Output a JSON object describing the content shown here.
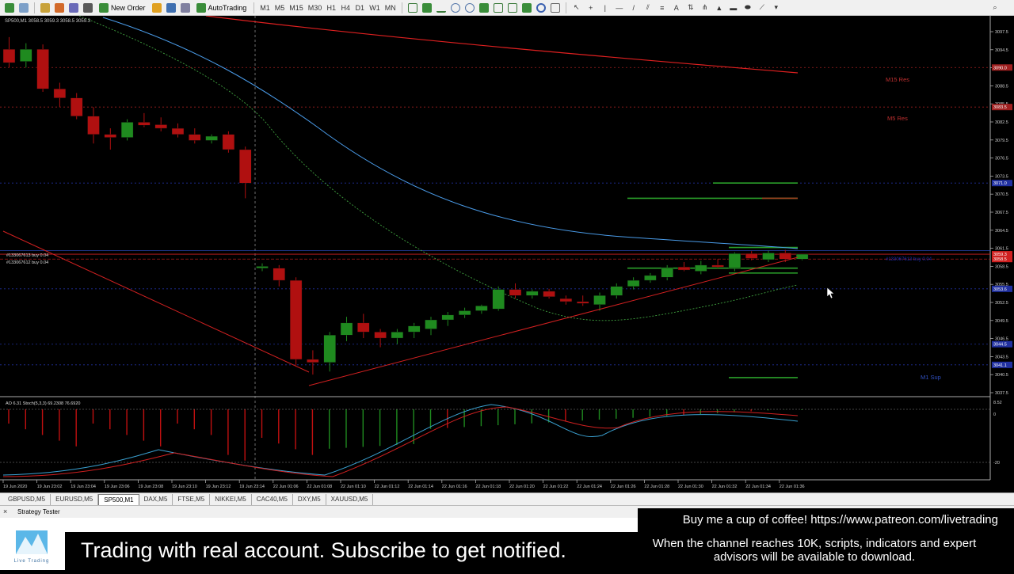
{
  "toolbar": {
    "new_order": "New Order",
    "auto_trading": "AutoTrading",
    "timeframes": [
      "M1",
      "M5",
      "M15",
      "M30",
      "H1",
      "H4",
      "D1",
      "W1",
      "MN"
    ]
  },
  "chart": {
    "symbol_info": "SP500,M1  3058.5 3059.3 3058.5 3059.3",
    "order_labels": [
      "#133067613 buy 0.04",
      "#133067612 buy 0.04"
    ],
    "level_labels": {
      "m15": "M15 Res",
      "m5": "M5 Res",
      "m1": "M1 Sup"
    },
    "right_order_label": "#133067613 buy 0.04",
    "price_axis": [
      "3097.5",
      "3094.5",
      "3091.5",
      "3088.5",
      "3085.5",
      "3082.5",
      "3079.5",
      "3076.5",
      "3073.5",
      "3070.5",
      "3067.5",
      "3064.5",
      "3061.5",
      "3058.5",
      "3055.5",
      "3052.5",
      "3049.5",
      "3046.5",
      "3043.5",
      "3040.5",
      "3037.5"
    ],
    "price_tags": [
      "3090.0",
      "3083.5",
      "3071.0",
      "3059.3",
      "3058.5",
      "3053.6",
      "3044.5",
      "3041.1"
    ],
    "indicator_label": "AO 6.31  Stoch(5,3,3) 69.2308 76.6920",
    "indicator_axis": [
      "8.52",
      "0",
      "-20"
    ],
    "time_axis": [
      "19 Jun 2020",
      "19 Jun 23:02",
      "19 Jun 23:04",
      "19 Jun 23:06",
      "19 Jun 23:08",
      "19 Jun 23:10",
      "19 Jun 23:12",
      "19 Jun 23:14",
      "22 Jun 01:06",
      "22 Jun 01:08",
      "22 Jun 01:10",
      "22 Jun 01:12",
      "22 Jun 01:14",
      "22 Jun 01:16",
      "22 Jun 01:18",
      "22 Jun 01:20",
      "22 Jun 01:22",
      "22 Jun 01:24",
      "22 Jun 01:26",
      "22 Jun 01:28",
      "22 Jun 01:30",
      "22 Jun 01:32",
      "22 Jun 01:34",
      "22 Jun 01:36"
    ],
    "candles": [
      {
        "o": 3093.0,
        "h": 3095.0,
        "l": 3090.0,
        "c": 3090.8
      },
      {
        "o": 3091.0,
        "h": 3094.0,
        "l": 3090.0,
        "c": 3093.0
      },
      {
        "o": 3093.0,
        "h": 3093.8,
        "l": 3086.0,
        "c": 3086.5
      },
      {
        "o": 3086.5,
        "h": 3087.5,
        "l": 3083.5,
        "c": 3085.0
      },
      {
        "o": 3085.0,
        "h": 3085.8,
        "l": 3081.5,
        "c": 3082.0
      },
      {
        "o": 3082.0,
        "h": 3083.5,
        "l": 3077.5,
        "c": 3079.0
      },
      {
        "o": 3079.0,
        "h": 3080.0,
        "l": 3076.5,
        "c": 3078.5
      },
      {
        "o": 3078.5,
        "h": 3081.5,
        "l": 3078.0,
        "c": 3081.0
      },
      {
        "o": 3081.0,
        "h": 3082.5,
        "l": 3080.2,
        "c": 3080.5
      },
      {
        "o": 3080.6,
        "h": 3081.8,
        "l": 3079.5,
        "c": 3080.0
      },
      {
        "o": 3080.0,
        "h": 3080.8,
        "l": 3078.5,
        "c": 3079.0
      },
      {
        "o": 3079.0,
        "h": 3080.0,
        "l": 3077.5,
        "c": 3078.0
      },
      {
        "o": 3078.0,
        "h": 3079.0,
        "l": 3077.5,
        "c": 3078.7
      },
      {
        "o": 3079.0,
        "h": 3079.5,
        "l": 3076.0,
        "c": 3076.5
      },
      {
        "o": 3076.5,
        "h": 3077.0,
        "l": 3068.5,
        "c": 3071.0
      },
      {
        "o": 3057.0,
        "h": 3057.8,
        "l": 3056.5,
        "c": 3057.3
      },
      {
        "o": 3057.0,
        "h": 3057.5,
        "l": 3054.0,
        "c": 3055.0
      },
      {
        "o": 3055.0,
        "h": 3055.5,
        "l": 3041.0,
        "c": 3042.0
      },
      {
        "o": 3042.0,
        "h": 3043.5,
        "l": 3039.5,
        "c": 3041.5
      },
      {
        "o": 3041.5,
        "h": 3046.5,
        "l": 3040.0,
        "c": 3046.0
      },
      {
        "o": 3046.0,
        "h": 3049.0,
        "l": 3045.0,
        "c": 3048.0
      },
      {
        "o": 3048.0,
        "h": 3049.5,
        "l": 3045.5,
        "c": 3046.5
      },
      {
        "o": 3046.5,
        "h": 3047.0,
        "l": 3044.0,
        "c": 3045.5
      },
      {
        "o": 3045.5,
        "h": 3047.0,
        "l": 3044.5,
        "c": 3046.5
      },
      {
        "o": 3046.5,
        "h": 3048.0,
        "l": 3045.5,
        "c": 3047.5
      },
      {
        "o": 3047.0,
        "h": 3049.0,
        "l": 3046.0,
        "c": 3048.5
      },
      {
        "o": 3048.5,
        "h": 3049.8,
        "l": 3047.5,
        "c": 3049.3
      },
      {
        "o": 3049.3,
        "h": 3050.5,
        "l": 3048.8,
        "c": 3050.0
      },
      {
        "o": 3050.0,
        "h": 3051.0,
        "l": 3049.5,
        "c": 3050.8
      },
      {
        "o": 3050.3,
        "h": 3054.0,
        "l": 3050.0,
        "c": 3053.5
      },
      {
        "o": 3053.5,
        "h": 3054.5,
        "l": 3052.0,
        "c": 3052.5
      },
      {
        "o": 3052.5,
        "h": 3053.5,
        "l": 3052.0,
        "c": 3053.2
      },
      {
        "o": 3053.2,
        "h": 3053.6,
        "l": 3052.0,
        "c": 3052.3
      },
      {
        "o": 3052.0,
        "h": 3052.5,
        "l": 3051.0,
        "c": 3051.5
      },
      {
        "o": 3051.5,
        "h": 3052.5,
        "l": 3050.8,
        "c": 3051.2
      },
      {
        "o": 3051.0,
        "h": 3053.0,
        "l": 3050.0,
        "c": 3052.5
      },
      {
        "o": 3052.5,
        "h": 3054.5,
        "l": 3052.0,
        "c": 3054.0
      },
      {
        "o": 3054.0,
        "h": 3055.5,
        "l": 3053.5,
        "c": 3055.0
      },
      {
        "o": 3055.0,
        "h": 3056.2,
        "l": 3054.6,
        "c": 3055.8
      },
      {
        "o": 3055.5,
        "h": 3057.5,
        "l": 3055.0,
        "c": 3057.0
      },
      {
        "o": 3057.2,
        "h": 3058.0,
        "l": 3056.5,
        "c": 3056.7
      },
      {
        "o": 3056.5,
        "h": 3058.2,
        "l": 3056.0,
        "c": 3057.5
      },
      {
        "o": 3057.5,
        "h": 3058.5,
        "l": 3057.0,
        "c": 3057.2
      },
      {
        "o": 3057.0,
        "h": 3059.6,
        "l": 3056.5,
        "c": 3059.4
      },
      {
        "o": 3059.4,
        "h": 3059.8,
        "l": 3058.3,
        "c": 3058.6
      },
      {
        "o": 3058.4,
        "h": 3059.9,
        "l": 3058.0,
        "c": 3059.5
      },
      {
        "o": 3059.5,
        "h": 3060.0,
        "l": 3058.0,
        "c": 3058.5
      },
      {
        "o": 3058.5,
        "h": 3059.3,
        "l": 3058.3,
        "c": 3059.3
      }
    ]
  },
  "tabs": [
    "GBPUSD,M5",
    "EURUSD,M5",
    "SP500,M1",
    "DAX,M5",
    "FTSE,M5",
    "NIKKEI,M5",
    "CAC40,M5",
    "DXY,M5",
    "XAUUSD,M5"
  ],
  "active_tab": "SP500,M1",
  "tester": {
    "label": "Strategy Tester",
    "close": "×"
  },
  "overlay": {
    "banner": "Trading with real account. Subscribe to get notified.",
    "coffee": "Buy me a cup of coffee! https://www.patreon.com/livetrading",
    "notice": "When the channel reaches 10K, scripts, indicators and expert advisors will be available to download.",
    "logo_text": "Live Trading"
  },
  "colors": {
    "bull": "#1f8a1f",
    "bear": "#b01010",
    "ma_blue": "#4a9be8",
    "ma_red": "#e02020",
    "ma_green": "#3fa03f"
  }
}
